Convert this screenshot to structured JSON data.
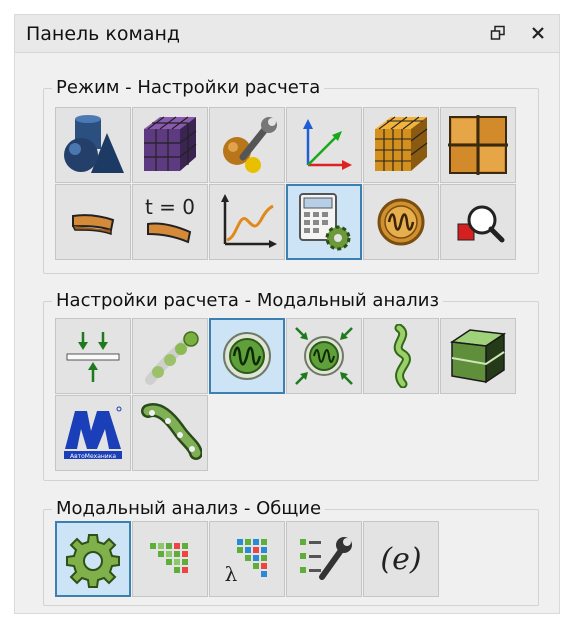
{
  "panel": {
    "title": "Панель команд",
    "float_icon": "restore-window-icon",
    "close_icon": "close-icon"
  },
  "groups": [
    {
      "label": "Режим - Настройки расчета",
      "buttons": [
        {
          "icon": "geometry-shapes-icon"
        },
        {
          "icon": "mesh-cube-icon"
        },
        {
          "icon": "material-wrench-icon"
        },
        {
          "icon": "coordinate-axes-icon"
        },
        {
          "icon": "fe-mesh-cube-icon"
        },
        {
          "icon": "grid-tiles-icon"
        },
        {
          "icon": "beam-element-icon"
        },
        {
          "icon": "initial-conditions-icon",
          "text": "t = 0"
        },
        {
          "icon": "graph-curve-icon"
        },
        {
          "icon": "calculation-settings-icon",
          "active": true
        },
        {
          "icon": "oscillation-signal-icon"
        },
        {
          "icon": "zoom-select-icon"
        }
      ]
    },
    {
      "label": "Настройки расчета - Модальный анализ",
      "buttons": [
        {
          "icon": "boundary-supports-icon"
        },
        {
          "icon": "mass-points-icon"
        },
        {
          "icon": "modal-analysis-icon",
          "active": true
        },
        {
          "icon": "modal-analysis-loads-icon"
        },
        {
          "icon": "twisted-ribbon-icon"
        },
        {
          "icon": "solid-block-icon"
        },
        {
          "icon": "automechanics-logo-icon",
          "text": "АвтоМеханика"
        },
        {
          "icon": "chain-link-icon"
        }
      ]
    },
    {
      "label": "Модальный анализ - Общие",
      "buttons": [
        {
          "icon": "gear-settings-icon",
          "active": true
        },
        {
          "icon": "colored-matrix-icon"
        },
        {
          "icon": "eigen-matrix-icon",
          "text": "λ"
        },
        {
          "icon": "list-settings-icon"
        },
        {
          "icon": "expression-icon",
          "text": "(e)"
        }
      ]
    }
  ]
}
